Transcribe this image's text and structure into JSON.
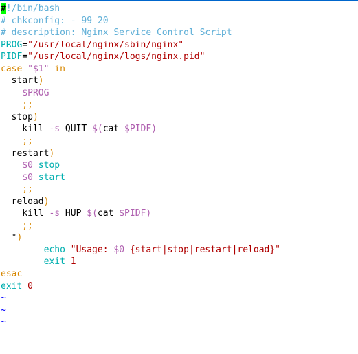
{
  "topbar": {},
  "lines": {
    "l1_hash": "#",
    "l1_rest": "!/bin/bash",
    "l2": "# chkconfig: - 99 20",
    "l3": "# description: Nginx Service Control Script",
    "l4_var": "PROG",
    "l4_eq": "=",
    "l4_val": "\"/usr/local/nginx/sbin/nginx\"",
    "l5_var": "PIDF",
    "l5_eq": "=",
    "l5_val": "\"/usr/local/nginx/logs/nginx.pid\"",
    "l6_case": "case",
    "l6_arg": " \"$1\" ",
    "l6_in": "in",
    "l7_start": "  start",
    "l7_paren": ")",
    "l8": "    $PROG",
    "l9": "    ;;",
    "l10_stop": "  stop",
    "l10_paren": ")",
    "l11_a": "    kill ",
    "l11_b": "-s",
    "l11_c": " QUIT ",
    "l11_d": "$(",
    "l11_e": "cat ",
    "l11_f": "$PIDF",
    "l11_g": ")",
    "l12": "    ;;",
    "l13_restart": "  restart",
    "l13_paren": ")",
    "l14_a": "    $0",
    "l14_b": " stop",
    "l15_a": "    $0",
    "l15_b": " start",
    "l16": "    ;;",
    "l17_reload": "  reload",
    "l17_paren": ")",
    "l18_a": "    kill ",
    "l18_b": "-s",
    "l18_c": " HUP ",
    "l18_d": "$(",
    "l18_e": "cat ",
    "l18_f": "$PIDF",
    "l18_g": ")",
    "l19": "    ;;",
    "l20_star": "  *",
    "l20_paren": ")",
    "l21_a": "        echo ",
    "l21_b": "\"Usage: ",
    "l21_c": "$0",
    "l21_d": " {start|stop|restart|reload}\"",
    "l22_a": "        exit ",
    "l22_b": "1",
    "l23": "esac",
    "l24_a": "exit ",
    "l24_b": "0",
    "tilde": "~"
  }
}
